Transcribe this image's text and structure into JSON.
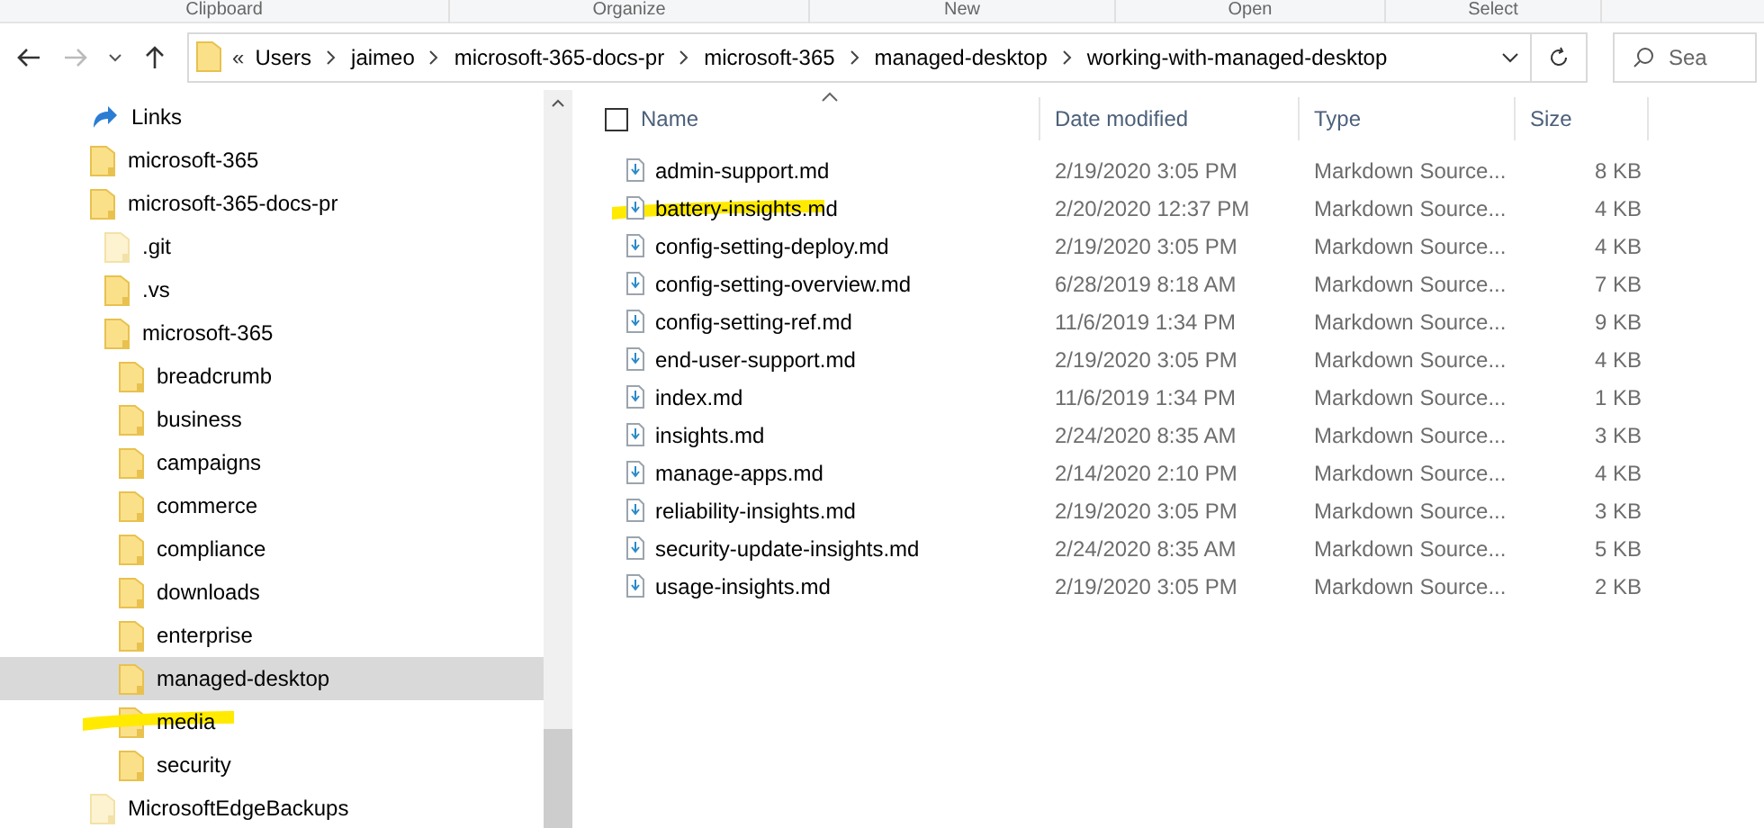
{
  "ribbon_groups": [
    "Clipboard",
    "Organize",
    "New",
    "Open",
    "Select"
  ],
  "address_bar": {
    "overflow": "«",
    "segments": [
      "Users",
      "jaimeo",
      "microsoft-365-docs-pr",
      "microsoft-365",
      "managed-desktop",
      "working-with-managed-desktop"
    ]
  },
  "search": {
    "placeholder": "Sea"
  },
  "tree": [
    {
      "label": "Links",
      "kind": "links",
      "selected": false,
      "highlighted": false
    },
    {
      "label": "microsoft-365",
      "kind": "folder",
      "selected": false,
      "highlighted": false
    },
    {
      "label": "microsoft-365-docs-pr",
      "kind": "folder",
      "selected": false,
      "highlighted": false,
      "children": [
        {
          "label": ".git",
          "kind": "hidden",
          "selected": false,
          "highlighted": false
        },
        {
          "label": ".vs",
          "kind": "folder",
          "selected": false,
          "highlighted": false
        },
        {
          "label": "microsoft-365",
          "kind": "folder",
          "selected": false,
          "highlighted": false,
          "children": [
            {
              "label": "breadcrumb",
              "kind": "folder",
              "selected": false,
              "highlighted": false
            },
            {
              "label": "business",
              "kind": "folder",
              "selected": false,
              "highlighted": false
            },
            {
              "label": "campaigns",
              "kind": "folder",
              "selected": false,
              "highlighted": false
            },
            {
              "label": "commerce",
              "kind": "folder",
              "selected": false,
              "highlighted": false
            },
            {
              "label": "compliance",
              "kind": "folder",
              "selected": false,
              "highlighted": false
            },
            {
              "label": "downloads",
              "kind": "folder",
              "selected": false,
              "highlighted": false
            },
            {
              "label": "enterprise",
              "kind": "folder",
              "selected": false,
              "highlighted": false
            },
            {
              "label": "managed-desktop",
              "kind": "folder",
              "selected": true,
              "highlighted": false
            },
            {
              "label": "media",
              "kind": "folder",
              "selected": false,
              "highlighted": true
            },
            {
              "label": "security",
              "kind": "folder",
              "selected": false,
              "highlighted": false
            }
          ]
        }
      ]
    },
    {
      "label": "MicrosoftEdgeBackups",
      "kind": "hidden",
      "selected": false,
      "highlighted": false
    }
  ],
  "table": {
    "select_all": {
      "checked": false
    },
    "columns": [
      "Name",
      "Date modified",
      "Type",
      "Size"
    ],
    "rows": [
      {
        "name": "admin-support.md",
        "date": "2/19/2020 3:05 PM",
        "type": "Markdown Source...",
        "size": "8 KB",
        "highlighted": false
      },
      {
        "name": "battery-insights.md",
        "date": "2/20/2020 12:37 PM",
        "type": "Markdown Source...",
        "size": "4 KB",
        "highlighted": true
      },
      {
        "name": "config-setting-deploy.md",
        "date": "2/19/2020 3:05 PM",
        "type": "Markdown Source...",
        "size": "4 KB",
        "highlighted": false
      },
      {
        "name": "config-setting-overview.md",
        "date": "6/28/2019 8:18 AM",
        "type": "Markdown Source...",
        "size": "7 KB",
        "highlighted": false
      },
      {
        "name": "config-setting-ref.md",
        "date": "11/6/2019 1:34 PM",
        "type": "Markdown Source...",
        "size": "9 KB",
        "highlighted": false
      },
      {
        "name": "end-user-support.md",
        "date": "2/19/2020 3:05 PM",
        "type": "Markdown Source...",
        "size": "4 KB",
        "highlighted": false
      },
      {
        "name": "index.md",
        "date": "11/6/2019 1:34 PM",
        "type": "Markdown Source...",
        "size": "1 KB",
        "highlighted": false
      },
      {
        "name": "insights.md",
        "date": "2/24/2020 8:35 AM",
        "type": "Markdown Source...",
        "size": "3 KB",
        "highlighted": false
      },
      {
        "name": "manage-apps.md",
        "date": "2/14/2020 2:10 PM",
        "type": "Markdown Source...",
        "size": "4 KB",
        "highlighted": false
      },
      {
        "name": "reliability-insights.md",
        "date": "2/19/2020 3:05 PM",
        "type": "Markdown Source...",
        "size": "3 KB",
        "highlighted": false
      },
      {
        "name": "security-update-insights.md",
        "date": "2/24/2020 8:35 AM",
        "type": "Markdown Source...",
        "size": "5 KB",
        "highlighted": false
      },
      {
        "name": "usage-insights.md",
        "date": "2/19/2020 3:05 PM",
        "type": "Markdown Source...",
        "size": "2 KB",
        "highlighted": false
      }
    ]
  }
}
